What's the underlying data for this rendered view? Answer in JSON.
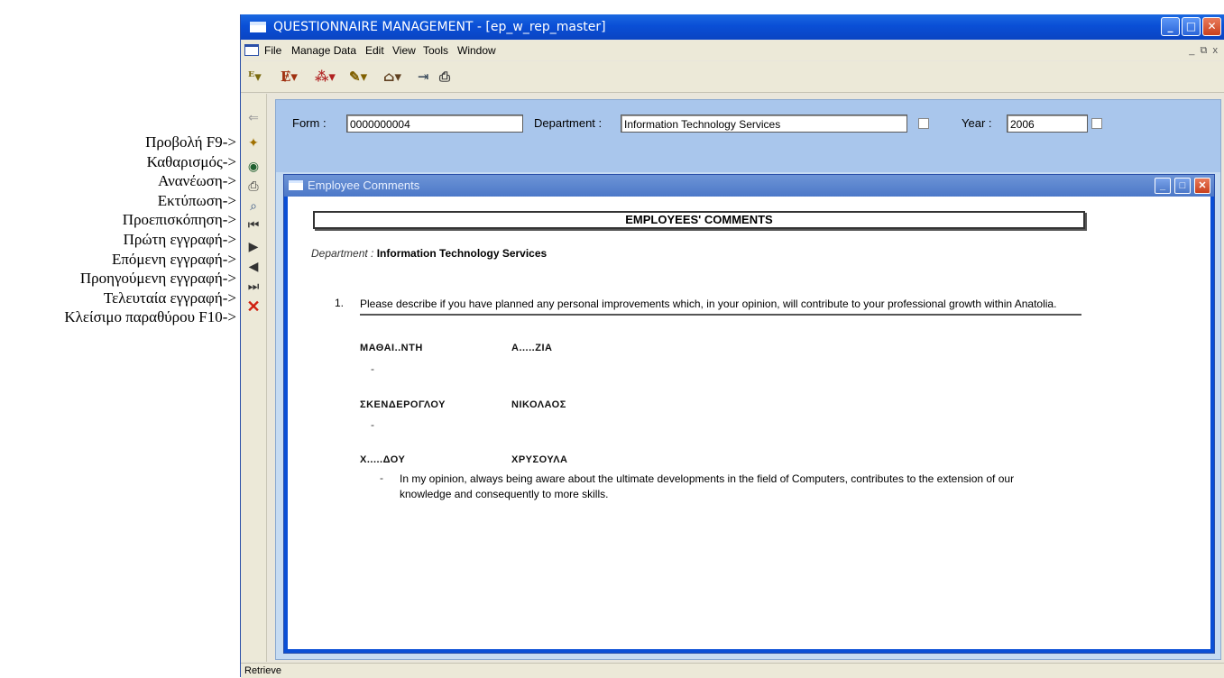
{
  "annotations": [
    "Προβολή F9->",
    "Καθαρισμός->",
    "Ανανέωση->",
    "Εκτύπωση->",
    "Προεπισκόπηση->",
    "Πρώτη εγγραφή->",
    "Επόμενη εγγραφή->",
    "Προηγούμενη εγγραφή->",
    "Τελευταία εγγραφή->",
    "Κλείσιμο παραθύρου F10->"
  ],
  "window": {
    "title": "QUESTIONNAIRE MANAGEMENT - [ep_w_rep_master]"
  },
  "menu": [
    "File",
    "Manage Data",
    "Edit",
    "View",
    "Tools",
    "Window"
  ],
  "form": {
    "form_label": "Form :",
    "form_value": "0000000004",
    "department_label": "Department :",
    "department_value": "Information Technology Services",
    "year_label": "Year :",
    "year_value": "2006"
  },
  "child_window": {
    "title": "Employee Comments"
  },
  "report": {
    "heading": "EMPLOYEES' COMMENTS",
    "department_label": "Department :",
    "department_value": "Information Technology Services",
    "question_number": "1.",
    "question_text": "Please describe if you have planned any personal improvements which, in your opinion, will contribute to your professional growth within Anatolia.",
    "responses": [
      {
        "surname": "ΜΑΘΑΙ..ΝΤΗ",
        "first_name": "Α.....ΖΙΑ",
        "dash": "-",
        "comment": ""
      },
      {
        "surname": "ΣΚΕΝΔΕΡΟΓΛΟΥ",
        "first_name": "ΝΙΚΟΛΑΟΣ",
        "dash": "-",
        "comment": ""
      },
      {
        "surname": "Χ.....ΔΟΥ",
        "first_name": "ΧΡΥΣΟΥΛΑ",
        "dash": "-",
        "comment": "In my opinion, always being aware about the ultimate developments in the field of Computers, contributes to the extension of our knowledge and consequently to more skills."
      }
    ]
  },
  "status": "Retrieve"
}
